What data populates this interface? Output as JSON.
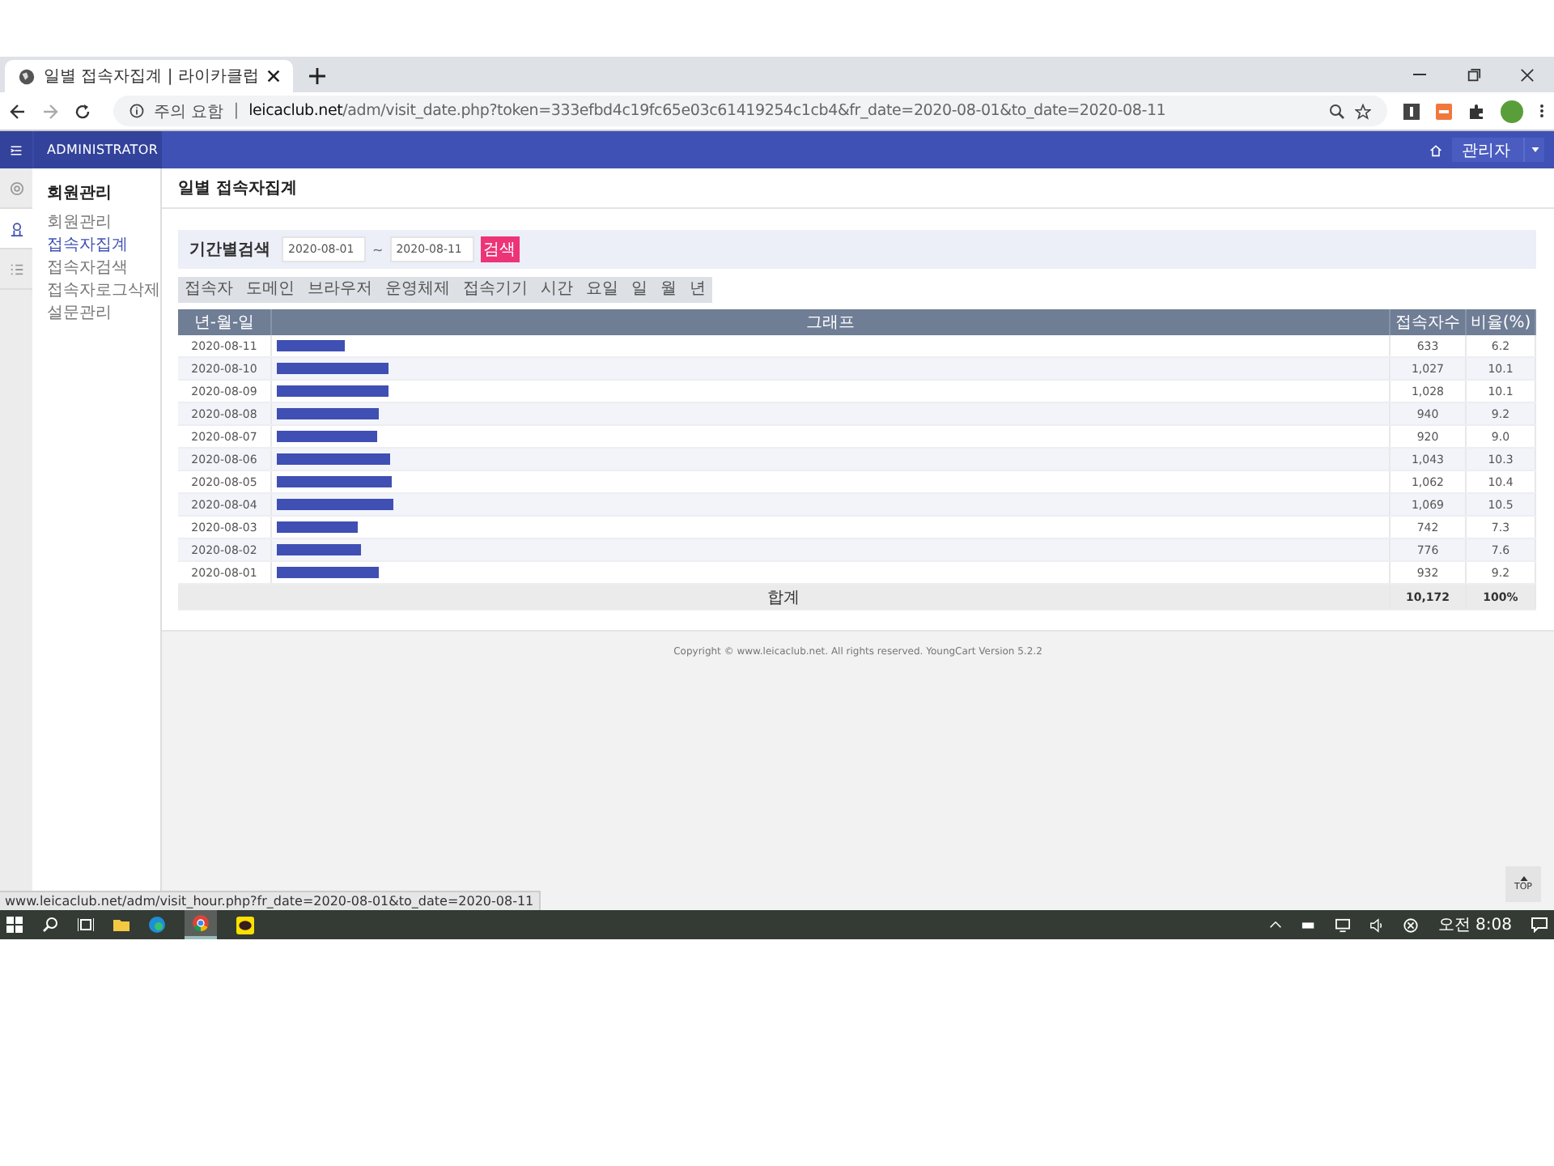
{
  "browser": {
    "tab_title": "일별 접속자집계 | 라이카클럽",
    "url_warning": "주의 요함",
    "url_separator": "|",
    "url_host": "leicaclub.net",
    "url_path": "/adm/visit_date.php?token=333efbd4c19fc65e03c61419254c1cb4&fr_date=2020-08-01&to_date=2020-08-11",
    "status_url": "www.leicaclub.net/adm/visit_hour.php?fr_date=2020-08-01&to_date=2020-08-11"
  },
  "header": {
    "brand": "ADMINISTRATOR",
    "user_menu": "관리자"
  },
  "rail": [
    {
      "kind": "gear",
      "selected": false
    },
    {
      "kind": "person",
      "selected": true
    },
    {
      "kind": "list",
      "selected": false
    }
  ],
  "sidebar": {
    "title": "회원관리",
    "items": [
      {
        "label": "회원관리",
        "selected": false
      },
      {
        "label": "접속자집계",
        "selected": true
      },
      {
        "label": "접속자검색",
        "selected": false
      },
      {
        "label": "접속자로그삭제",
        "selected": false
      },
      {
        "label": "설문관리",
        "selected": false
      }
    ]
  },
  "page_title": "일별 접속자집계",
  "filter": {
    "label": "기간별검색",
    "from": "2020-08-01",
    "separator": "~",
    "to": "2020-08-11",
    "button": "검색"
  },
  "tabs": [
    "접속자",
    "도메인",
    "브라우저",
    "운영체제",
    "접속기기",
    "시간",
    "요일",
    "일",
    "월",
    "년"
  ],
  "table": {
    "columns": [
      "년-월-일",
      "그래프",
      "접속자수",
      "비율(%)"
    ],
    "rows": [
      {
        "date": "2020-08-11",
        "level": 0.062,
        "count": "633",
        "ratio": "6.2"
      },
      {
        "date": "2020-08-10",
        "level": 0.101,
        "count": "1,027",
        "ratio": "10.1"
      },
      {
        "date": "2020-08-09",
        "level": 0.101,
        "count": "1,028",
        "ratio": "10.1"
      },
      {
        "date": "2020-08-08",
        "level": 0.092,
        "count": "940",
        "ratio": "9.2"
      },
      {
        "date": "2020-08-07",
        "level": 0.09,
        "count": "920",
        "ratio": "9.0"
      },
      {
        "date": "2020-08-06",
        "level": 0.103,
        "count": "1,043",
        "ratio": "10.3"
      },
      {
        "date": "2020-08-05",
        "level": 0.104,
        "count": "1,062",
        "ratio": "10.4"
      },
      {
        "date": "2020-08-04",
        "level": 0.105,
        "count": "1,069",
        "ratio": "10.5"
      },
      {
        "date": "2020-08-03",
        "level": 0.073,
        "count": "742",
        "ratio": "7.3"
      },
      {
        "date": "2020-08-02",
        "level": 0.076,
        "count": "776",
        "ratio": "7.6"
      },
      {
        "date": "2020-08-01",
        "level": 0.092,
        "count": "932",
        "ratio": "9.2"
      }
    ],
    "total": {
      "label": "합계",
      "count": "10,172",
      "ratio": "100%"
    }
  },
  "footer": "Copyright © www.leicaclub.net. All rights reserved. YoungCart Version 5.2.2",
  "top_button": "TOP",
  "taskbar": {
    "time": "오전 8:08"
  }
}
